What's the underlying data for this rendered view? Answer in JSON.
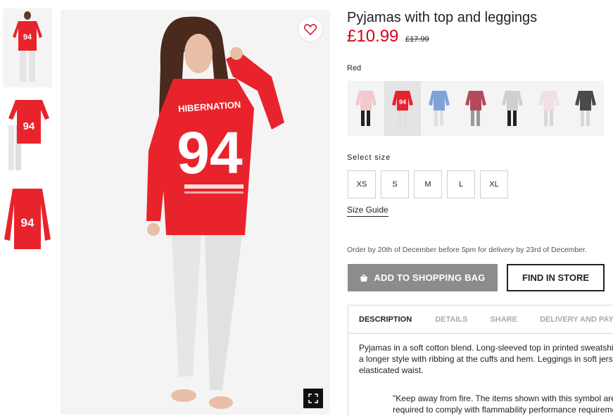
{
  "product": {
    "title": "Pyjamas with top and leggings",
    "price_now": "£10.99",
    "price_old": "£17.99",
    "selected_color": "Red"
  },
  "thumbnails": [
    {
      "alt": "model-front"
    },
    {
      "alt": "flat-lay-with-leggings"
    },
    {
      "alt": "top-only"
    }
  ],
  "colors": {
    "brand_red": "#e8232c",
    "price_red": "#d6001c",
    "swatches": [
      "#f2c9cc",
      "#e8232c",
      "#7fa3d8",
      "#b24a5a",
      "#cfcfcf",
      "#f0e0e4",
      "#4a4a4a"
    ]
  },
  "top_print": {
    "word": "HIBERNATION",
    "number": "94"
  },
  "size_section": {
    "label": "Select size",
    "sizes": [
      "XS",
      "S",
      "M",
      "L",
      "XL"
    ],
    "guide_link": "Size Guide"
  },
  "order_note": "Order by 20th of December before 5pm for delivery by 23rd of December.",
  "buttons": {
    "add_to_bag": "ADD TO SHOPPING BAG",
    "find_in_store": "FIND IN STORE"
  },
  "tabs": [
    "DESCRIPTION",
    "DETAILS",
    "SHARE",
    "DELIVERY AND PAYMENT"
  ],
  "description_lines": [
    "Pyjamas in a soft cotton blend. Long-sleeved top in printed sweatshirt fabric in",
    "a longer style with ribbing at the cuffs and hem. Leggings in soft jersey with an",
    "elasticated waist."
  ],
  "warning_lines": [
    "\"Keep away from fire. The items shown with this symbol are",
    "required to comply with flammability performance requirements"
  ],
  "icons": {
    "favourite": "heart-icon",
    "zoom": "fullscreen-icon",
    "bag": "shopping-bag-icon"
  }
}
